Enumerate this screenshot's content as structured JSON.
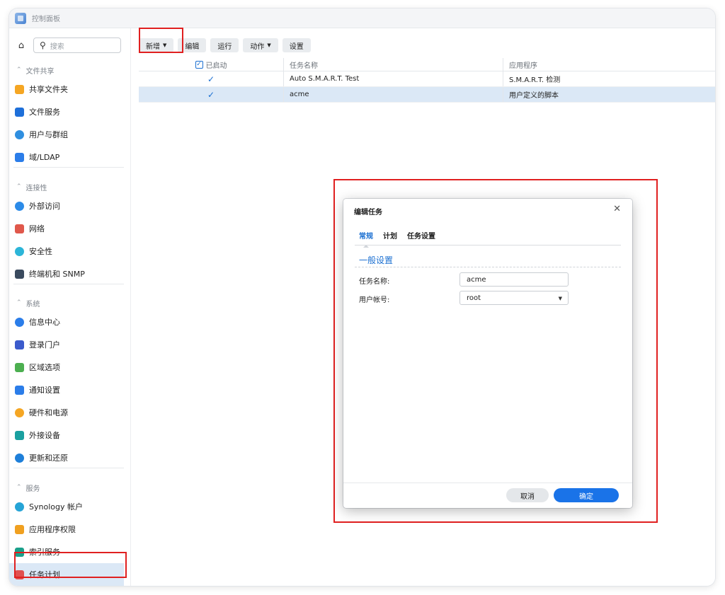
{
  "window": {
    "title": "控制面板"
  },
  "sidebar": {
    "search_placeholder": "搜索",
    "groups": [
      {
        "label": "文件共享",
        "items": [
          {
            "label": "共享文件夹",
            "color": "#f5a623"
          },
          {
            "label": "文件服务",
            "color": "#1e6fd9"
          },
          {
            "label": "用户与群组",
            "color": "#2f8fe0"
          },
          {
            "label": "域/LDAP",
            "color": "#2b7de9"
          }
        ]
      },
      {
        "label": "连接性",
        "items": [
          {
            "label": "外部访问",
            "color": "#2c8be8"
          },
          {
            "label": "网络",
            "color": "#e0584b"
          },
          {
            "label": "安全性",
            "color": "#2cb5d8"
          },
          {
            "label": "终端机和 SNMP",
            "color": "#3a4a5e"
          }
        ]
      },
      {
        "label": "系统",
        "items": [
          {
            "label": "信息中心",
            "color": "#2b7de9"
          },
          {
            "label": "登录门户",
            "color": "#3b5bcc"
          },
          {
            "label": "区域选项",
            "color": "#4caf50"
          },
          {
            "label": "通知设置",
            "color": "#2b7de9"
          },
          {
            "label": "硬件和电源",
            "color": "#f5a623"
          },
          {
            "label": "外接设备",
            "color": "#1aa0a0"
          },
          {
            "label": "更新和还原",
            "color": "#1e7fd9"
          }
        ]
      },
      {
        "label": "服务",
        "items": [
          {
            "label": "Synology 帐户",
            "color": "#26a4d6"
          },
          {
            "label": "应用程序权限",
            "color": "#f0a020"
          },
          {
            "label": "索引服务",
            "color": "#1aa08a"
          },
          {
            "label": "任务计划",
            "color": "#e05050",
            "active": true
          }
        ]
      }
    ]
  },
  "toolbar": {
    "create": "新增",
    "edit": "编辑",
    "run": "运行",
    "action": "动作",
    "settings": "设置"
  },
  "table": {
    "headers": {
      "enabled": "已启动",
      "task_name": "任务名称",
      "application": "应用程序"
    },
    "rows": [
      {
        "enabled": true,
        "task_name": "Auto S.M.A.R.T. Test",
        "application": "S.M.A.R.T. 检测",
        "selected": false
      },
      {
        "enabled": true,
        "task_name": "acme",
        "application": "用户定义的脚本",
        "selected": true
      }
    ]
  },
  "dialog": {
    "title": "编辑任务",
    "tabs": [
      "常规",
      "计划",
      "任务设置"
    ],
    "active_tab": "常规",
    "section_title": "一般设置",
    "fields": {
      "task_name_label": "任务名称:",
      "task_name_value": "acme",
      "user_label": "用户帐号:",
      "user_value": "root"
    },
    "cancel": "取消",
    "ok": "确定"
  },
  "colors": {
    "accent": "#1a73e8",
    "highlight": "#e02020",
    "selection": "#dbe8f6"
  }
}
